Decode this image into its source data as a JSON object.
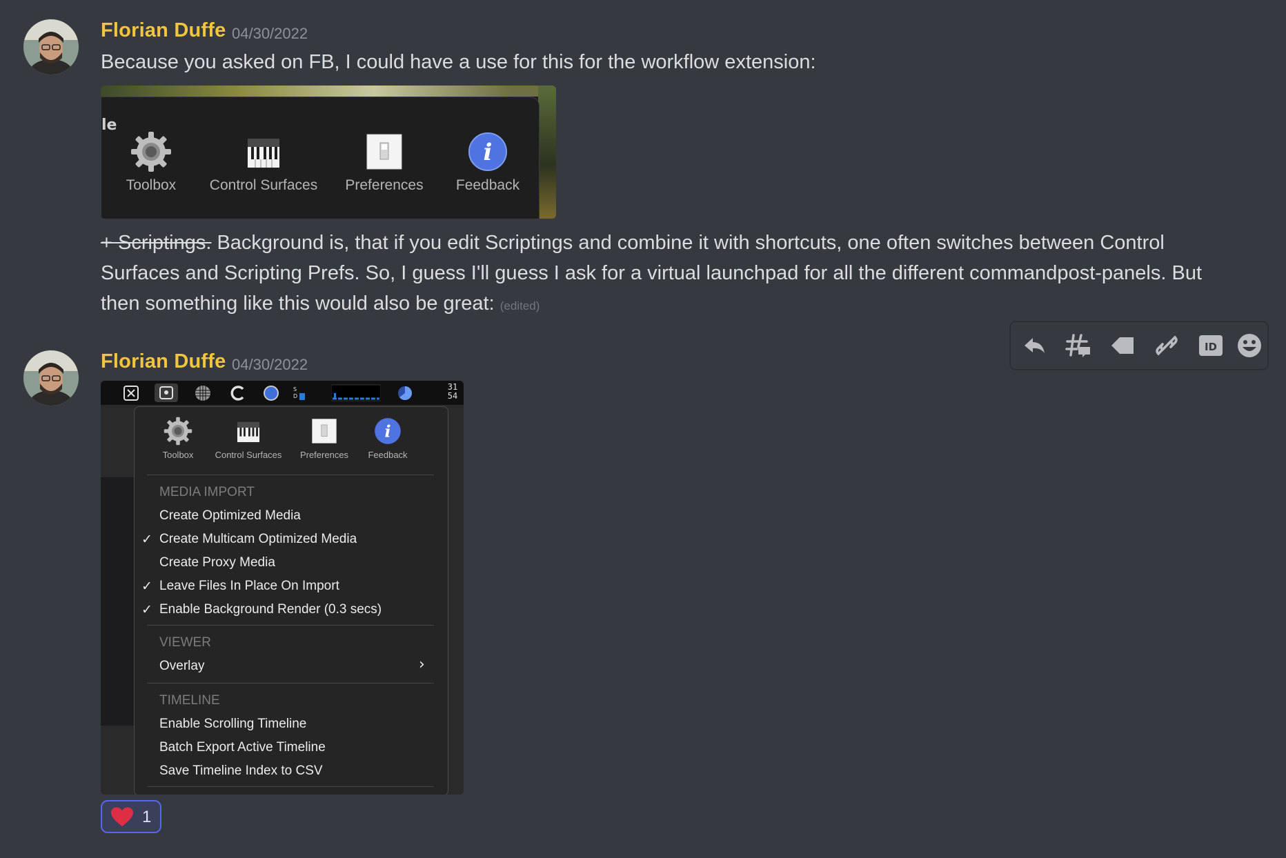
{
  "messages": [
    {
      "author": "Florian Duffe",
      "timestamp": "04/30/2022",
      "text_line1": "Because you asked on FB, I could have a use for this for the workflow extension:",
      "image1": {
        "header_fragment": "le",
        "toolbar": [
          "Toolbox",
          "Control Surfaces",
          "Preferences",
          "Feedback"
        ]
      },
      "strike_text": "+ Scriptings.",
      "body_line1_rest": " Background is, that if you edit Scriptings and combine it with shortcuts, one often switches between Control",
      "body_line2": "Surfaces and Scripting Prefs. So, I guess I'll guess I ask for a virtual launchpad for all the different commandpost-panels. But",
      "body_line3": "then something like this would also be great:",
      "edited_label": "(edited)"
    },
    {
      "author": "Florian Duffe",
      "timestamp": "04/30/2022",
      "image2": {
        "menubar_clock": [
          "31",
          "54"
        ],
        "toolbar": [
          "Toolbox",
          "Control Surfaces",
          "Preferences",
          "Feedback"
        ],
        "sections": [
          {
            "header": "MEDIA IMPORT",
            "items": [
              {
                "label": "Create Optimized Media",
                "checked": false
              },
              {
                "label": "Create Multicam Optimized Media",
                "checked": true
              },
              {
                "label": "Create Proxy Media",
                "checked": false
              },
              {
                "label": "Leave Files In Place On Import",
                "checked": true
              },
              {
                "label": "Enable Background Render (0.3 secs)",
                "checked": true
              }
            ]
          },
          {
            "header": "VIEWER",
            "items": [
              {
                "label": "Overlay",
                "submenu": true
              }
            ]
          },
          {
            "header": "TIMELINE",
            "items": [
              {
                "label": "Enable Scrolling Timeline"
              },
              {
                "label": "Batch Export Active Timeline"
              },
              {
                "label": "Save Timeline Index to CSV"
              }
            ]
          }
        ],
        "check_glyph": "✓",
        "chevron_glyph": "›"
      },
      "reaction": {
        "emoji": "heart-icon",
        "count": "1"
      }
    }
  ],
  "message_toolbar": {
    "icons": [
      "reply-icon",
      "thread-icon",
      "tag-icon",
      "link-icon",
      "id-icon",
      "emoji-icon"
    ]
  },
  "colors": {
    "background": "#36393f",
    "username": "#f0c541",
    "timestamp": "#8e9297",
    "text": "#dcddde",
    "reaction_border": "#5865f2",
    "heart": "#dd2e44"
  }
}
